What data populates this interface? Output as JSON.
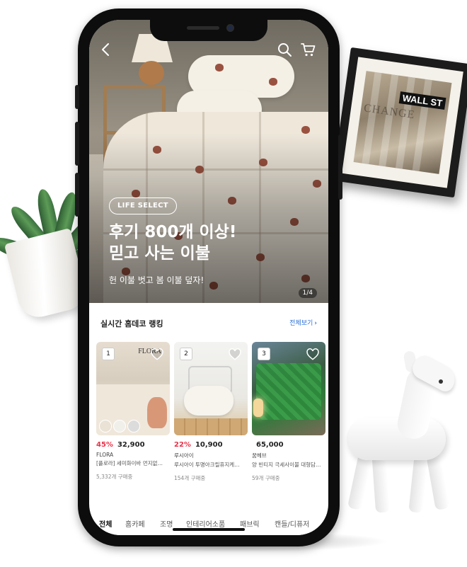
{
  "hero": {
    "badge": "LIFE SELECT",
    "title": "후기 800개 이상!\n믿고 사는 이불",
    "subtitle": "헌 이불 벗고 봄 이불 덮자!",
    "pager": "1/4",
    "icons": {
      "back": "chevron-left-icon",
      "search": "search-icon",
      "cart": "cart-icon"
    }
  },
  "ranking": {
    "title": "실시간 홈데코 랭킹",
    "view_all": "전체보기",
    "items": [
      {
        "rank": "1",
        "discount": "45%",
        "price": "32,900",
        "brand": "FLORA",
        "name": "[플로라] 세미화이바 먼지없…",
        "sold": "5,332개 구매중",
        "logo_text": "FLORA"
      },
      {
        "rank": "2",
        "discount": "22%",
        "price": "10,900",
        "brand": "루시아이",
        "name": "루시아이 투명아크릴휴지케…",
        "sold": "154개 구매중"
      },
      {
        "rank": "3",
        "discount": "",
        "price": "65,000",
        "brand": "꿈헤브",
        "name": "양 빈티지 극세사이불 대형담…",
        "sold": "59개 구매중"
      }
    ]
  },
  "tabs": [
    "전체",
    "홈카페",
    "조명",
    "인테리어소품",
    "패브릭",
    "캔들/디퓨저"
  ],
  "decor": {
    "frame_sign": "WALL ST",
    "frame_engraving": "CHANGE"
  },
  "colors": {
    "accent": "#e8334a",
    "link": "#2a6fd6",
    "bear_print": "#9a5240"
  }
}
